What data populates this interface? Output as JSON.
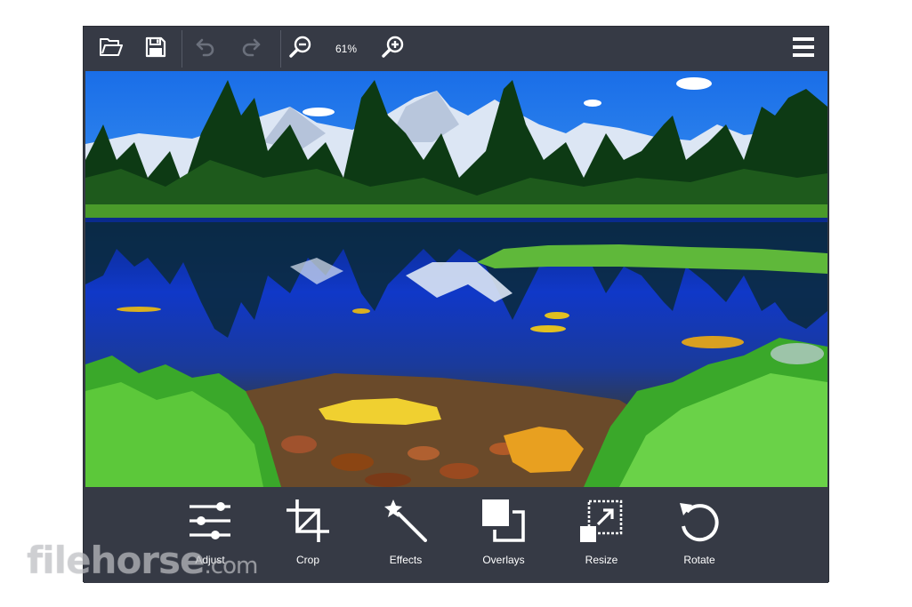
{
  "toolbar": {
    "buttons": [
      {
        "name": "open",
        "icon": "folder-open-icon",
        "enabled": true
      },
      {
        "name": "save",
        "icon": "save-icon",
        "enabled": true
      },
      {
        "name": "undo",
        "icon": "undo-icon",
        "enabled": false
      },
      {
        "name": "redo",
        "icon": "redo-icon",
        "enabled": false
      },
      {
        "name": "zoom-out",
        "icon": "zoom-out-icon",
        "enabled": true
      },
      {
        "name": "zoom-in",
        "icon": "zoom-in-icon",
        "enabled": true
      },
      {
        "name": "menu",
        "icon": "hamburger-menu-icon",
        "enabled": true
      }
    ],
    "zoom_level": "61%"
  },
  "canvas": {
    "image_subject": "mountain lake landscape with pine trees and reflection"
  },
  "tools": [
    {
      "label": "Adjust",
      "icon": "sliders-icon"
    },
    {
      "label": "Crop",
      "icon": "crop-icon"
    },
    {
      "label": "Effects",
      "icon": "magic-wand-icon"
    },
    {
      "label": "Overlays",
      "icon": "overlays-icon"
    },
    {
      "label": "Resize",
      "icon": "resize-icon"
    },
    {
      "label": "Rotate",
      "icon": "rotate-icon"
    }
  ],
  "watermark": {
    "text": "filehorse",
    "tld": ".com"
  },
  "colors": {
    "panel": "#363a45",
    "icon": "#ffffff",
    "icon_disabled": "#6b707c"
  }
}
